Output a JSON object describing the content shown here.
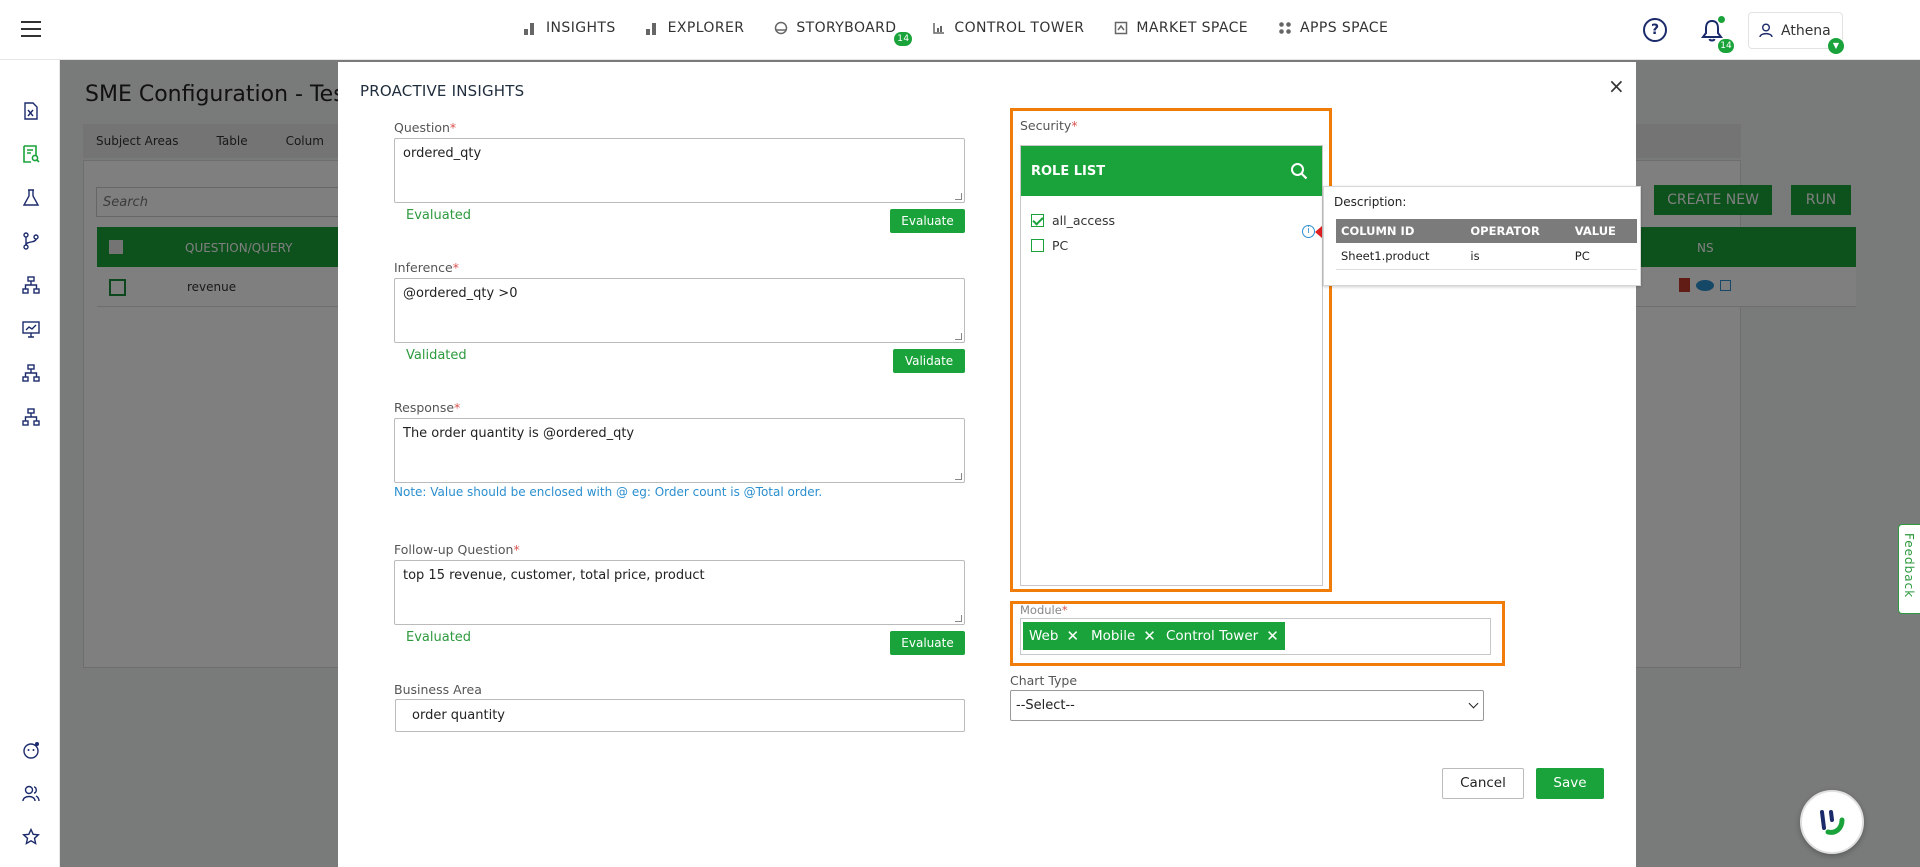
{
  "nav": {
    "items": [
      {
        "label": "INSIGHTS",
        "icon": "bar-chart-icon"
      },
      {
        "label": "EXPLORER",
        "icon": "bar-chart-icon"
      },
      {
        "label": "STORYBOARD",
        "icon": "storyboard-icon",
        "badge": "14"
      },
      {
        "label": "CONTROL TOWER",
        "icon": "control-tower-icon"
      },
      {
        "label": "MARKET SPACE",
        "icon": "market-space-icon"
      },
      {
        "label": "APPS SPACE",
        "icon": "apps-space-icon"
      }
    ],
    "notification_badge": "14",
    "user_name": "Athena"
  },
  "background": {
    "title": "SME Configuration - Tes",
    "tabs": [
      "Subject Areas",
      "Table",
      "Colum"
    ],
    "search_placeholder": "Search",
    "create_new_label": "CREATE NEW",
    "run_label": "RUN",
    "table": {
      "header_question": "QUESTION/QUERY",
      "header_actions": "NS",
      "rows": [
        "revenue"
      ]
    }
  },
  "modal": {
    "title": "PROACTIVE INSIGHTS",
    "close_label": "×",
    "question": {
      "label": "Question",
      "value": "ordered_qty",
      "status": "Evaluated",
      "button": "Evaluate"
    },
    "inference": {
      "label": "Inference",
      "value": "@ordered_qty >0",
      "status": "Validated",
      "button": "Validate"
    },
    "response": {
      "label": "Response",
      "value": "The order quantity is @ordered_qty",
      "note": "Note: Value should be enclosed with @ eg: Order count is @Total order."
    },
    "followup": {
      "label": "Follow-up Question",
      "value": "top 15 revenue, customer, total price, product",
      "status": "Evaluated",
      "button": "Evaluate"
    },
    "business_area": {
      "label": "Business Area",
      "value": "order quantity"
    },
    "security": {
      "label": "Security",
      "role_list_title": "ROLE LIST",
      "roles": [
        {
          "name": "all_access",
          "checked": true
        },
        {
          "name": "PC",
          "checked": false
        }
      ]
    },
    "description": {
      "label": "Description:",
      "columns": [
        "COLUMN ID",
        "OPERATOR",
        "VALUE"
      ],
      "rows": [
        [
          "Sheet1.product",
          "is",
          "PC"
        ]
      ]
    },
    "module": {
      "label": "Module",
      "chips": [
        "Web",
        "Mobile",
        "Control Tower"
      ]
    },
    "chart_type": {
      "label": "Chart Type",
      "selected": "--Select--"
    },
    "cancel_label": "Cancel",
    "save_label": "Save"
  },
  "feedback_label": "Feedback",
  "colors": {
    "accent": "#1aa33a",
    "highlight": "#f07d0a",
    "link": "#2b8fcf",
    "required": "#d9534f"
  }
}
